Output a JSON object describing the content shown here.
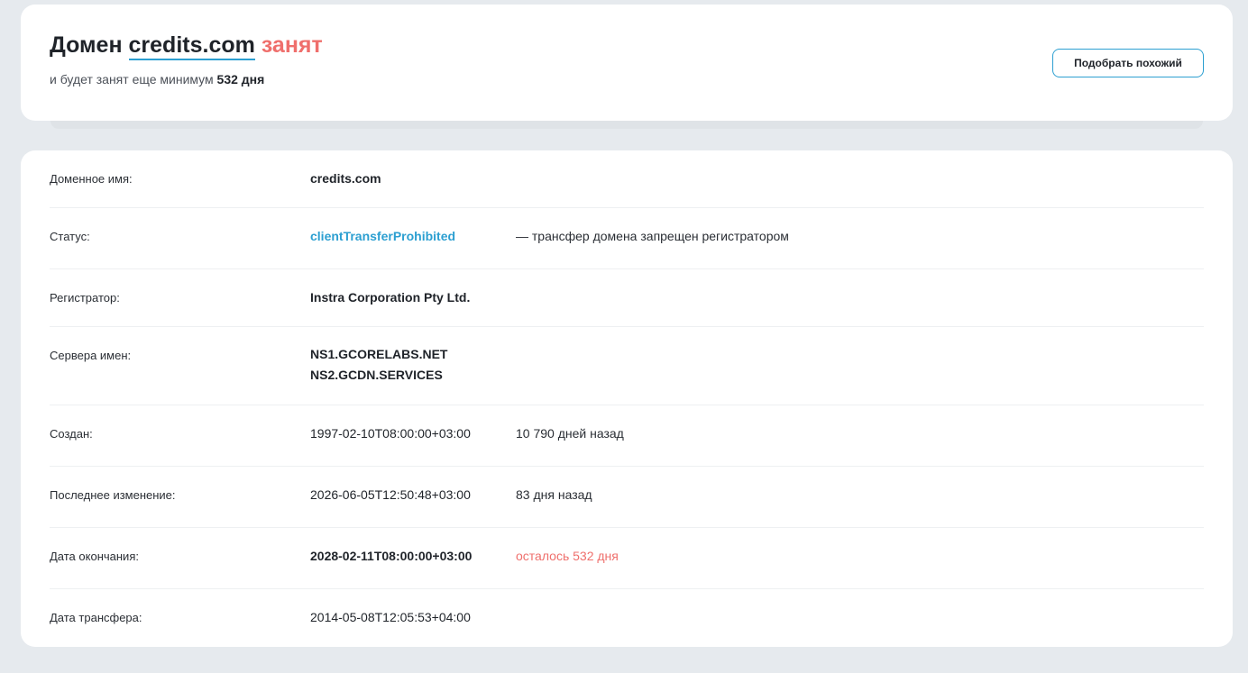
{
  "header": {
    "prefix": "Домен",
    "domain": "credits.com",
    "status_word": "занят",
    "sub_text": "и будет занят еще минимум",
    "sub_days": "532 дня",
    "button_label": "Подобрать похожий"
  },
  "rows": {
    "domain": {
      "label": "Доменное имя:",
      "value": "credits.com"
    },
    "status": {
      "label": "Статус:",
      "value": "clientTransferProhibited",
      "note": "— трансфер домена запрещен регистратором"
    },
    "registrar": {
      "label": "Регистратор:",
      "value": "Instra Corporation Pty Ltd."
    },
    "nameservers": {
      "label": "Сервера имен:",
      "values": [
        "NS1.GCORELABS.NET",
        "NS2.GCDN.SERVICES"
      ]
    },
    "created": {
      "label": "Создан:",
      "value": "1997-02-10T08:00:00+03:00",
      "note": "10 790 дней назад"
    },
    "updated": {
      "label": "Последнее изменение:",
      "value": "2026-06-05T12:50:48+03:00",
      "note": "83 дня назад"
    },
    "expires": {
      "label": "Дата окончания:",
      "value": "2028-02-11T08:00:00+03:00",
      "note": "осталось 532 дня"
    },
    "transfer": {
      "label": "Дата трансфера:",
      "value": "2014-05-08T12:05:53+04:00"
    }
  },
  "colors": {
    "accent": "#2c9fd1",
    "busy": "#ef6f6c",
    "background": "#e6eaee"
  }
}
